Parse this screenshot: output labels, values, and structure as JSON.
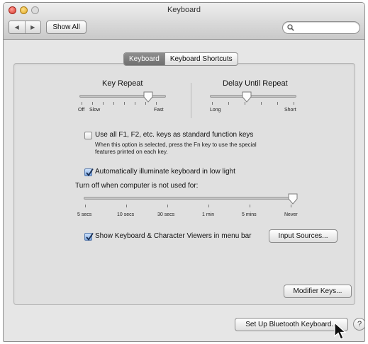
{
  "window": {
    "title": "Keyboard",
    "nav_back": "◀",
    "nav_forward": "▶",
    "show_all": "Show All",
    "search_placeholder": ""
  },
  "tabs": [
    {
      "label": "Keyboard",
      "selected": true
    },
    {
      "label": "Keyboard Shortcuts",
      "selected": false
    }
  ],
  "key_repeat": {
    "title": "Key Repeat",
    "left_labels": [
      "Off",
      "Slow"
    ],
    "right_label": "Fast",
    "value_fraction": 0.83
  },
  "delay_until_repeat": {
    "title": "Delay Until Repeat",
    "left_label": "Long",
    "right_label": "Short",
    "value_fraction": 0.42
  },
  "function_keys": {
    "checked": false,
    "label": "Use all F1, F2, etc. keys as standard function keys",
    "help_line1": "When this option is selected, press the Fn key to use the special",
    "help_line2": "features printed on each key."
  },
  "illuminate": {
    "checked": true,
    "label": "Automatically illuminate keyboard in low light",
    "turn_off_label": "Turn off when computer is not used for:",
    "ticks": [
      "5 secs",
      "10 secs",
      "30 secs",
      "1 min",
      "5 mins",
      "Never"
    ],
    "value": "Never"
  },
  "viewers": {
    "checked": true,
    "label": "Show Keyboard & Character Viewers in menu bar",
    "input_sources_button": "Input Sources..."
  },
  "buttons": {
    "modifier_keys": "Modifier Keys...",
    "bluetooth": "Set Up Bluetooth Keyboard...",
    "help": "?"
  },
  "colors": {
    "window_bg": "#e6e6e6",
    "accent_checkbox": "#7fa9e3",
    "active_tab": "#7a7a7a"
  }
}
